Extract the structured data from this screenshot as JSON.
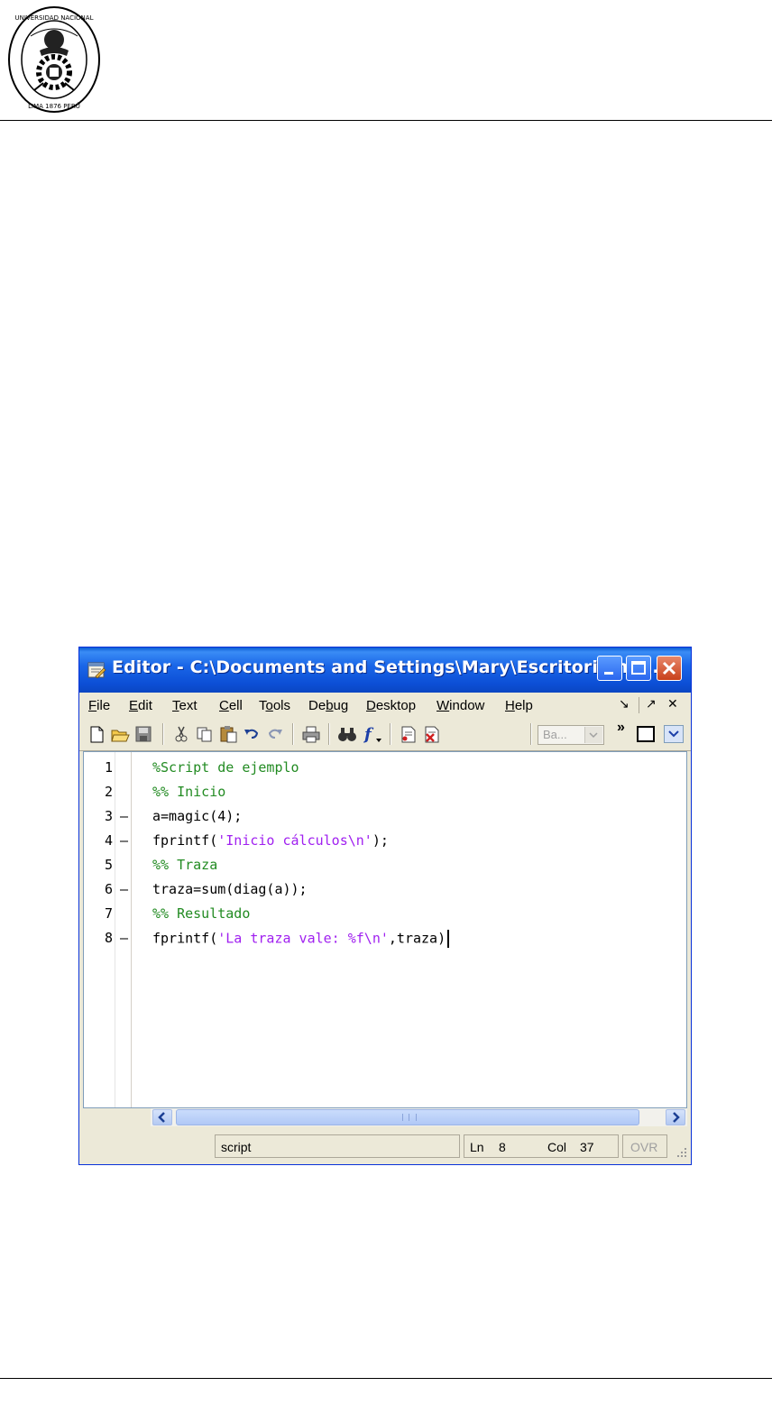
{
  "header": {
    "seal_text": "UNIVERSIDAD NACIONAL DE INGENIERÍA · LIMA 1876 PERÚ"
  },
  "window": {
    "title": "Editor - C:\\Documents and Settings\\Mary\\Escritorio\\ma...",
    "menu": [
      {
        "label": "File",
        "mnemonic_index": 0
      },
      {
        "label": "Edit",
        "mnemonic_index": 0
      },
      {
        "label": "Text",
        "mnemonic_index": 0
      },
      {
        "label": "Cell",
        "mnemonic_index": 0
      },
      {
        "label": "Tools",
        "mnemonic_index": 1
      },
      {
        "label": "Debug",
        "mnemonic_index": 2
      },
      {
        "label": "Desktop",
        "mnemonic_index": 0
      },
      {
        "label": "Window",
        "mnemonic_index": 0
      },
      {
        "label": "Help",
        "mnemonic_index": 0
      }
    ],
    "menu_right": {
      "undock": "↘",
      "dock": "↗",
      "close": "✕"
    },
    "toolbar": {
      "stack_select_value": "Ba...",
      "overflow": "»"
    },
    "code_lines": [
      {
        "num": "1",
        "breakpoint": "",
        "segments": [
          {
            "t": "%Script de ejemplo",
            "k": "comment"
          }
        ]
      },
      {
        "num": "2",
        "breakpoint": "",
        "segments": [
          {
            "t": "%% Inicio",
            "k": "comment"
          }
        ]
      },
      {
        "num": "3",
        "breakpoint": "–",
        "segments": [
          {
            "t": "a=magic(4);",
            "k": "normal"
          }
        ]
      },
      {
        "num": "4",
        "breakpoint": "–",
        "segments": [
          {
            "t": "fprintf(",
            "k": "normal"
          },
          {
            "t": "'Inicio cálculos\\n'",
            "k": "string"
          },
          {
            "t": ");",
            "k": "normal"
          }
        ]
      },
      {
        "num": "5",
        "breakpoint": "",
        "segments": [
          {
            "t": "%% Traza",
            "k": "comment"
          }
        ]
      },
      {
        "num": "6",
        "breakpoint": "–",
        "segments": [
          {
            "t": "traza=sum(diag(a));",
            "k": "normal"
          }
        ]
      },
      {
        "num": "7",
        "breakpoint": "",
        "segments": [
          {
            "t": "%% Resultado",
            "k": "comment"
          }
        ]
      },
      {
        "num": "8",
        "breakpoint": "–",
        "segments": [
          {
            "t": "fprintf(",
            "k": "normal"
          },
          {
            "t": "'La traza vale: %f\\n'",
            "k": "string"
          },
          {
            "t": ",traza)",
            "k": "normal"
          }
        ]
      }
    ],
    "scrollbar": {
      "thumb_position": 0.0
    },
    "status": {
      "type": "script",
      "ln_label": "Ln",
      "ln_value": "8",
      "col_label": "Col",
      "col_value": "37",
      "ovr": "OVR"
    },
    "colors": {
      "comment": "#228b22",
      "string": "#a020f0",
      "titlebar": "#0a46c2"
    }
  }
}
